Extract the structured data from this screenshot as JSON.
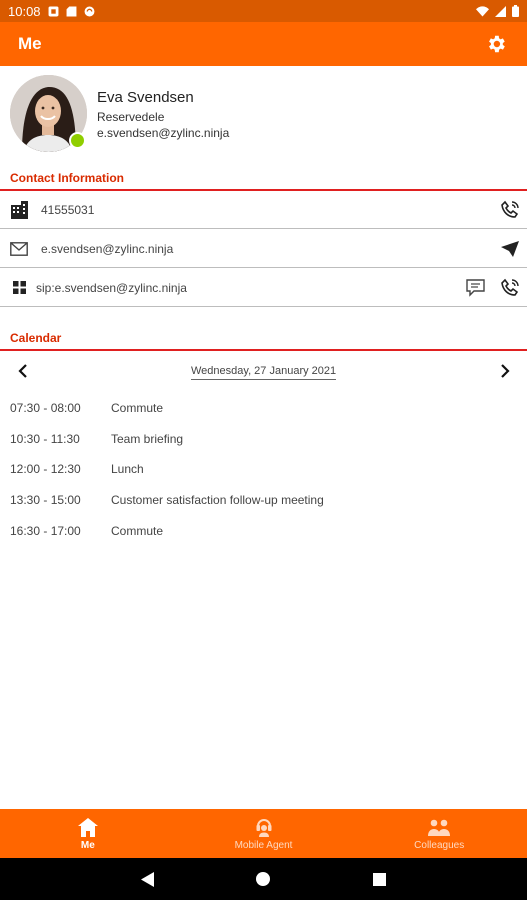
{
  "status_bar": {
    "time": "10:08"
  },
  "app_bar": {
    "title": "Me"
  },
  "profile": {
    "name": "Eva Svendsen",
    "department": "Reservedele",
    "email": "e.svendsen@zylinc.ninja",
    "presence_color": "#8fce00"
  },
  "contact": {
    "title": "Contact Information",
    "rows": [
      {
        "icon": "building-icon",
        "text": "41555031",
        "actions": [
          "phone-call-icon"
        ]
      },
      {
        "icon": "envelope-icon",
        "text": "e.svendsen@zylinc.ninja",
        "actions": [
          "send-icon"
        ]
      },
      {
        "icon": "grid-icon",
        "text": "sip:e.svendsen@zylinc.ninja",
        "actions": [
          "chat-icon",
          "phone-call-icon"
        ]
      }
    ]
  },
  "calendar": {
    "title": "Calendar",
    "date": "Wednesday, 27 January 2021",
    "events": [
      {
        "time": "07:30 - 08:00",
        "title": "Commute"
      },
      {
        "time": "10:30 - 11:30",
        "title": "Team briefing"
      },
      {
        "time": "12:00 - 12:30",
        "title": "Lunch"
      },
      {
        "time": "13:30 - 15:00",
        "title": "Customer satisfaction follow-up meeting"
      },
      {
        "time": "16:30 - 17:00",
        "title": "Commute"
      }
    ]
  },
  "bottom_nav": {
    "items": [
      {
        "label": "Me",
        "icon": "home-icon",
        "active": true
      },
      {
        "label": "Mobile Agent",
        "icon": "headset-icon",
        "active": false
      },
      {
        "label": "Colleagues",
        "icon": "people-icon",
        "active": false
      }
    ]
  },
  "colors": {
    "accent": "#ff6600",
    "status_bar": "#d95a00",
    "section_title": "#d92b00",
    "section_line": "#e02020"
  }
}
